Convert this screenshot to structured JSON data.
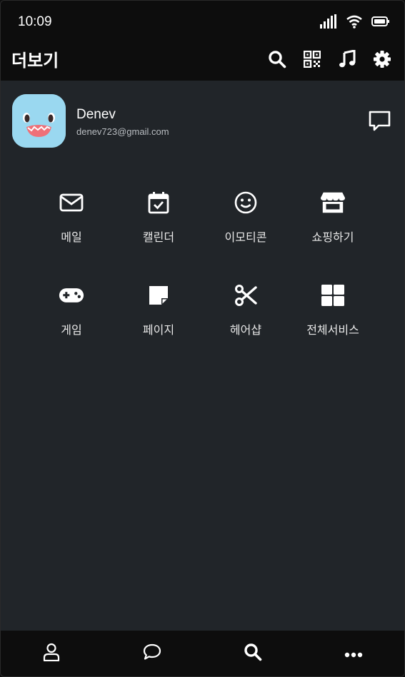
{
  "status": {
    "time": "10:09"
  },
  "appbar": {
    "title": "더보기"
  },
  "profile": {
    "name": "Denev",
    "email": "denev723@gmail.com"
  },
  "services": [
    {
      "label": "메일",
      "icon": "mail-icon"
    },
    {
      "label": "캘린더",
      "icon": "calendar-icon"
    },
    {
      "label": "이모티콘",
      "icon": "smile-icon"
    },
    {
      "label": "쇼핑하기",
      "icon": "store-icon"
    },
    {
      "label": "게임",
      "icon": "gamepad-icon"
    },
    {
      "label": "페이지",
      "icon": "page-icon"
    },
    {
      "label": "헤어샵",
      "icon": "scissors-icon"
    },
    {
      "label": "전체서비스",
      "icon": "grid-icon"
    }
  ],
  "bottom_tabs": [
    {
      "icon": "person-icon"
    },
    {
      "icon": "chat-icon"
    },
    {
      "icon": "search-icon"
    },
    {
      "icon": "more-icon"
    }
  ],
  "colors": {
    "background": "#212529",
    "bars": "#0d0d0d",
    "avatar": "#9ad8f0"
  }
}
